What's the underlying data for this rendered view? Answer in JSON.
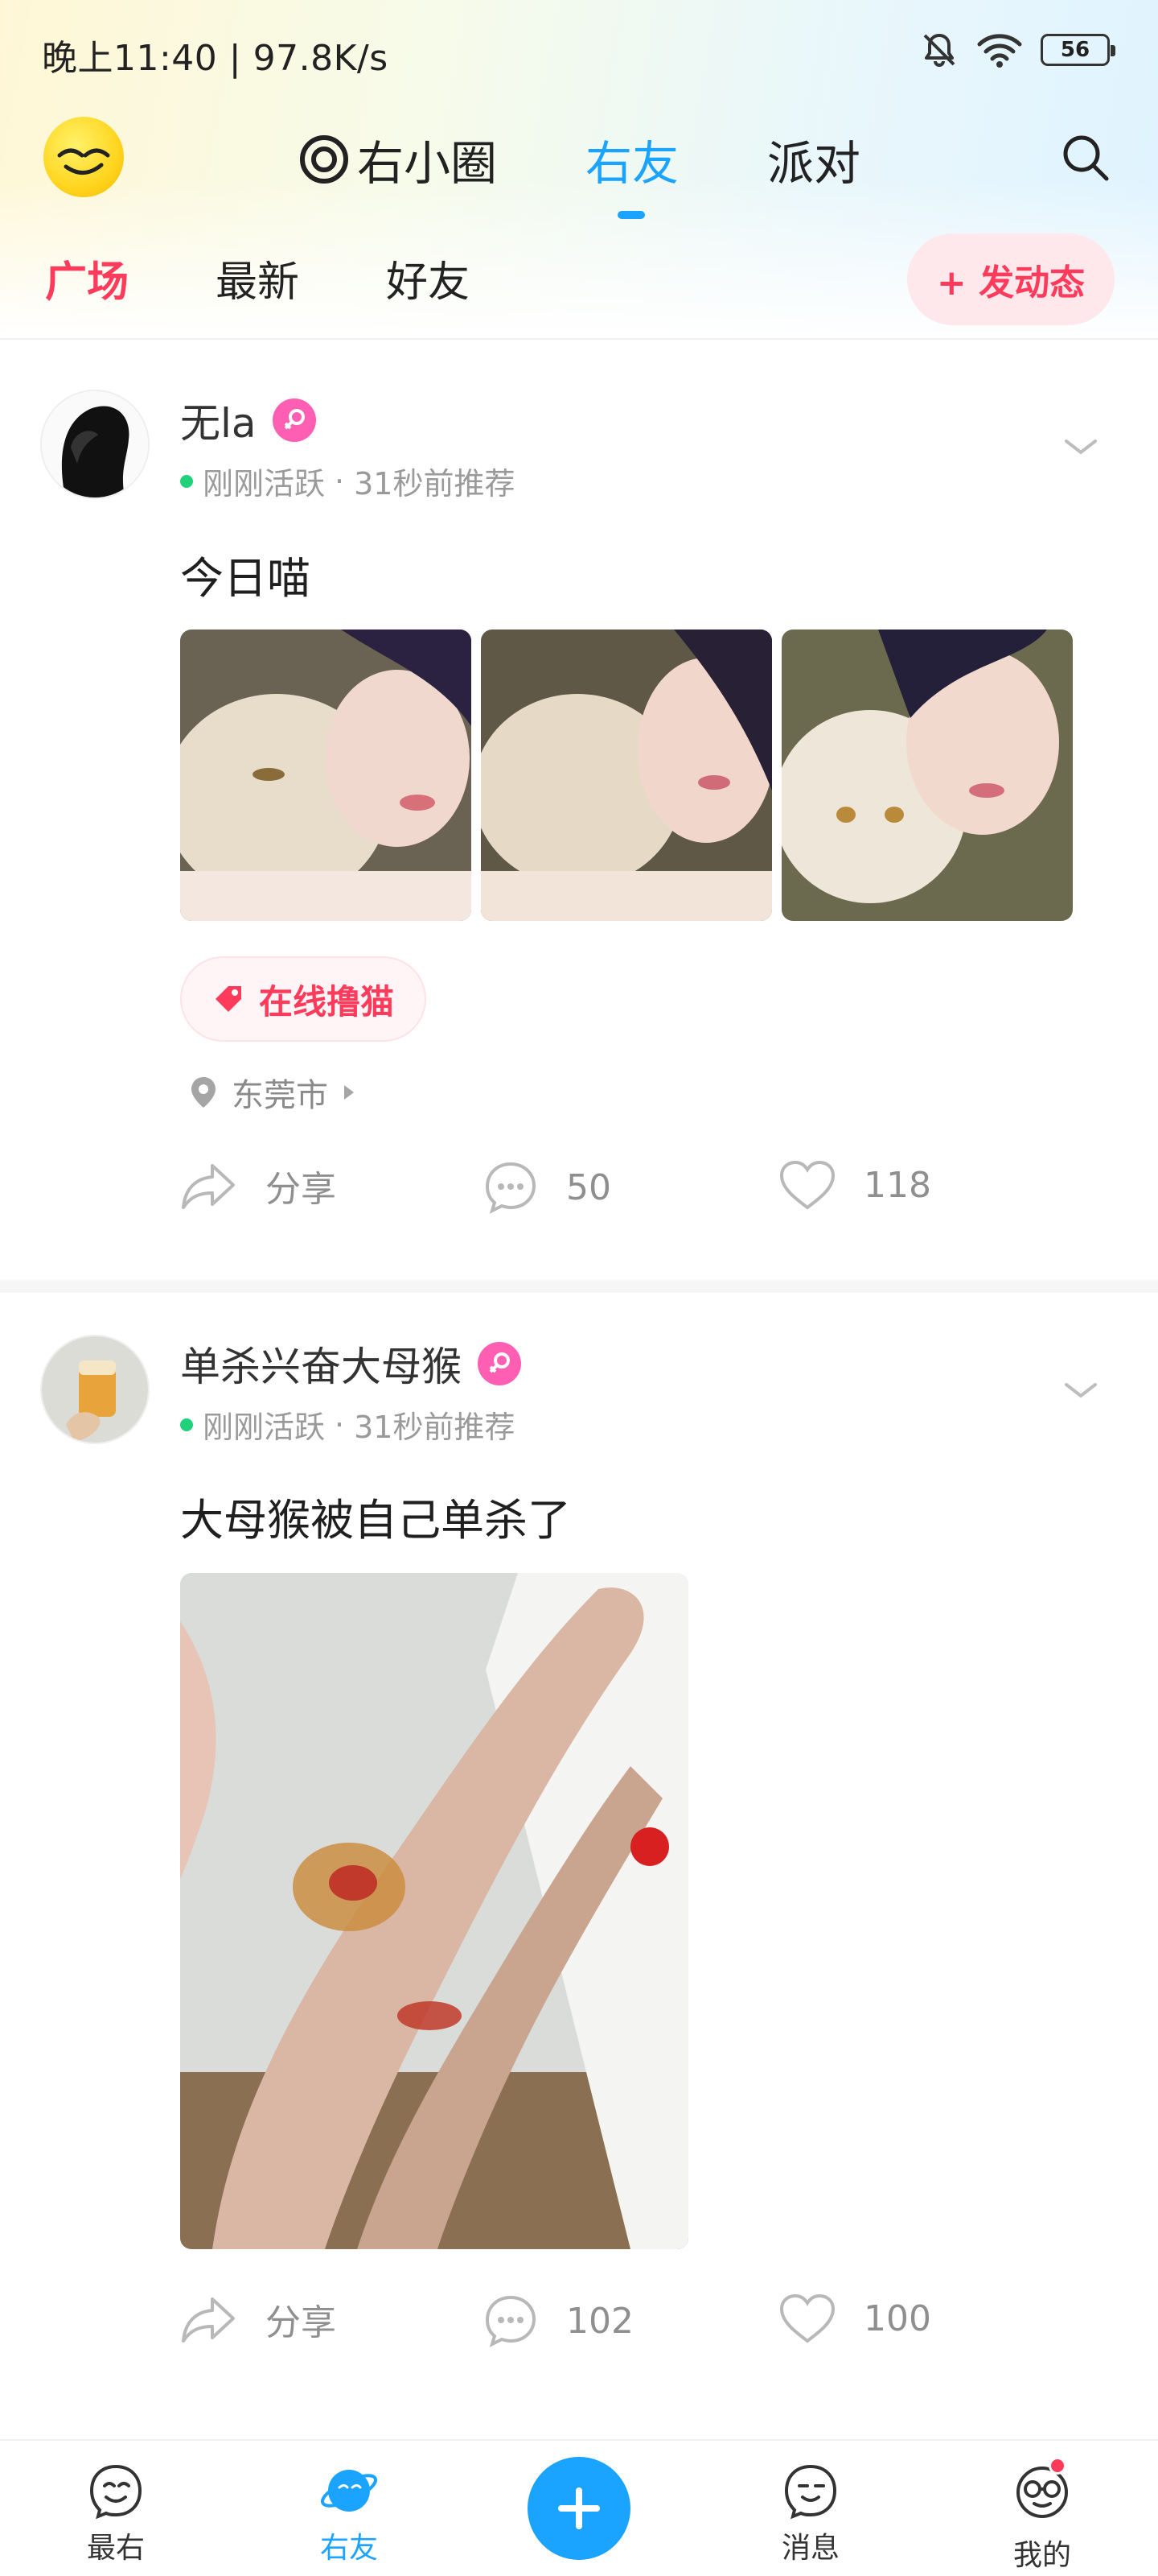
{
  "status_bar": {
    "time_speed": "晚上11:40 | 97.8K/s",
    "battery": "56"
  },
  "top_nav": {
    "tabs": [
      {
        "label": "右小圈",
        "icon": "circle-at-icon"
      },
      {
        "label": "右友"
      },
      {
        "label": "派对"
      }
    ],
    "active_tab": "右友",
    "search_icon": "search-icon"
  },
  "sub_nav": {
    "tabs": [
      "广场",
      "最新",
      "好友"
    ],
    "active_tab": "广场",
    "post_button": "+ 发动态"
  },
  "posts": [
    {
      "username": "无la",
      "gender": "female",
      "status": "刚刚活跃",
      "recommend": "31秒前推荐",
      "text": "今日喵",
      "tag": "在线撸猫",
      "location": "东莞市",
      "share": "分享",
      "comments": "50",
      "likes": "118"
    },
    {
      "username": "单杀兴奋大母猴",
      "gender": "female",
      "status": "刚刚活跃",
      "recommend": "31秒前推荐",
      "text": "大母猴被自己单杀了",
      "share": "分享",
      "comments": "102",
      "likes": "100"
    }
  ],
  "bottom_nav": {
    "items": [
      {
        "label": "最右",
        "icon": "smile-face-icon"
      },
      {
        "label": "右友",
        "icon": "planet-icon"
      },
      {
        "label": "",
        "icon": "plus-icon"
      },
      {
        "label": "消息",
        "icon": "message-face-icon"
      },
      {
        "label": "我的",
        "icon": "glasses-face-icon"
      }
    ],
    "active": "右友"
  },
  "colors": {
    "accent_blue": "#1aa3ff",
    "accent_red": "#ff3b5c",
    "online_green": "#20d07a",
    "female_pink": "#ff5fb3"
  }
}
